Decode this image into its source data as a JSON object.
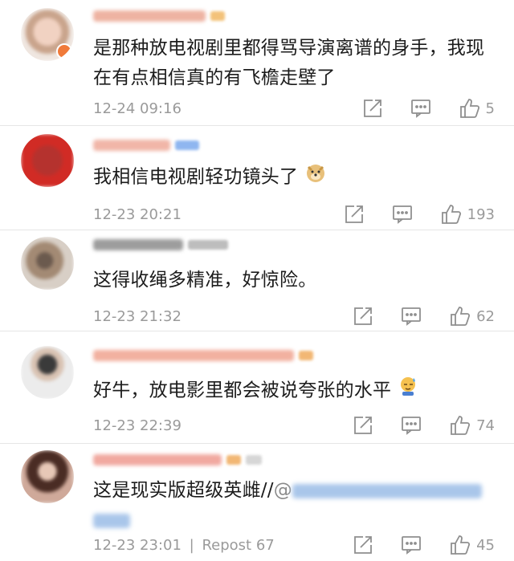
{
  "comments": [
    {
      "text": "是那种放电视剧里都得骂导演离谱的身手，我现在有点相信真的有飞檐走壁了",
      "time": "12-24 09:16",
      "likes": "5"
    },
    {
      "text": "我相信电视剧轻功镜头了",
      "emoji": "doge-emoji",
      "time": "12-23 20:21",
      "likes": "193"
    },
    {
      "text": "这得收绳多精准，好惊险。",
      "time": "12-23 21:32",
      "likes": "62"
    },
    {
      "text": "好牛，放电影里都会被说夸张的水平",
      "emoji": "sweat-emoji",
      "time": "12-23 22:39",
      "likes": "74"
    },
    {
      "text": "这是现实版超级英雌//",
      "mention_prefix": "@",
      "time": "12-23 23:01",
      "separator": "|",
      "repost": "Repost 67",
      "likes": "45"
    }
  ],
  "icons": {
    "share": "share-icon",
    "comment": "comment-icon",
    "like": "thumbs-up-icon"
  },
  "colors": {
    "meta_gray": "#9a9a9a",
    "divider": "#e6e6e6",
    "username_red": "#e8846a"
  }
}
